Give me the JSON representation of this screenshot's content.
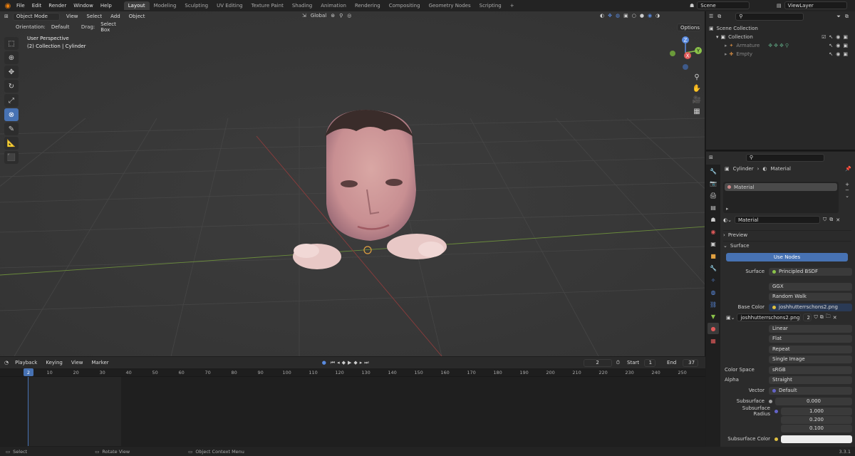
{
  "topbar": {
    "menus": [
      "File",
      "Edit",
      "Render",
      "Window",
      "Help"
    ],
    "workspaces": [
      "Layout",
      "Modeling",
      "Sculpting",
      "UV Editing",
      "Texture Paint",
      "Shading",
      "Animation",
      "Rendering",
      "Compositing",
      "Geometry Nodes",
      "Scripting"
    ],
    "active_workspace": "Layout",
    "add_tab": "+",
    "scene": "Scene",
    "view_layer": "ViewLayer"
  },
  "viewport": {
    "mode": "Object Mode",
    "menus": [
      "View",
      "Select",
      "Add",
      "Object"
    ],
    "orientation_label": "Orientation:",
    "orientation_value": "Default",
    "drag_label": "Drag:",
    "drag_value": "Select Box",
    "transform_orientation": "Global",
    "options": "Options",
    "info_line1": "User Perspective",
    "info_line2": "(2) Collection | Cylinder",
    "gizmo_labels": {
      "z": "Z",
      "y": "Y",
      "x": "X"
    }
  },
  "timeline": {
    "menus": [
      "Playback",
      "Keying",
      "View",
      "Marker"
    ],
    "current_frame": "2",
    "start_label": "Start",
    "start_value": "1",
    "end_label": "End",
    "end_value": "37",
    "ruler": [
      "2",
      "10",
      "20",
      "30",
      "40",
      "50",
      "60",
      "70",
      "80",
      "90",
      "100",
      "110",
      "120",
      "130",
      "140",
      "150",
      "160",
      "170",
      "180",
      "190",
      "200",
      "210",
      "220",
      "230",
      "240",
      "250"
    ]
  },
  "statusbar": {
    "select": "Select",
    "rotate": "Rotate View",
    "context": "Object Context Menu",
    "version": "3.3.1"
  },
  "outliner": {
    "scene_collection": "Scene Collection",
    "collection": "Collection",
    "items": [
      "Armature",
      "Empty"
    ]
  },
  "properties": {
    "breadcrumb_object": "Cylinder",
    "breadcrumb_material": "Material",
    "material_slot": "Material",
    "material_name": "Material",
    "panel_preview": "Preview",
    "panel_surface": "Surface",
    "use_nodes": "Use Nodes",
    "surface_label": "Surface",
    "surface_value": "Principled BSDF",
    "distribution": "GGX",
    "subsurface_method": "Random Walk",
    "base_color_label": "Base Color",
    "base_color_value": "joshhutterrschons2.png",
    "image_name": "joshhutterrschons2.png",
    "image_users": "2",
    "interpolation": "Linear",
    "projection": "Flat",
    "extension": "Repeat",
    "source": "Single Image",
    "color_space_label": "Color Space",
    "color_space_value": "sRGB",
    "alpha_label": "Alpha",
    "alpha_value": "Straight",
    "vector_label": "Vector",
    "vector_value": "Default",
    "subsurface_label": "Subsurface",
    "subsurface_value": "0.000",
    "subsurface_radius_label": "Subsurface Radius",
    "subsurface_radius": [
      "1.000",
      "0.200",
      "0.100"
    ],
    "subsurface_color_label": "Subsurface Color"
  }
}
